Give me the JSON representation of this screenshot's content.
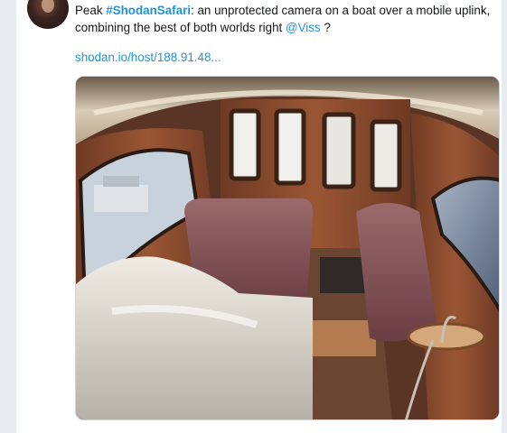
{
  "tweet": {
    "text_prefix": "Peak ",
    "hashtag": "#ShodanSafari",
    "text_middle": ": an unprotected camera on a boat over a mobile uplink, combining the best of both worlds right ",
    "mention": "@Viss",
    "text_suffix": " ?",
    "link": "shodan.io/host/188.91.48..."
  },
  "media": {
    "description_icon": "camera-photo",
    "colors": {
      "wood": "#8a4a30",
      "upholstery": "#8a5a5e",
      "cover": "#d8d4cc",
      "ceiling": "#e8dcc8"
    }
  },
  "theme": {
    "link_color": "#1b95e0",
    "rule_color": "#e6ecf0"
  }
}
